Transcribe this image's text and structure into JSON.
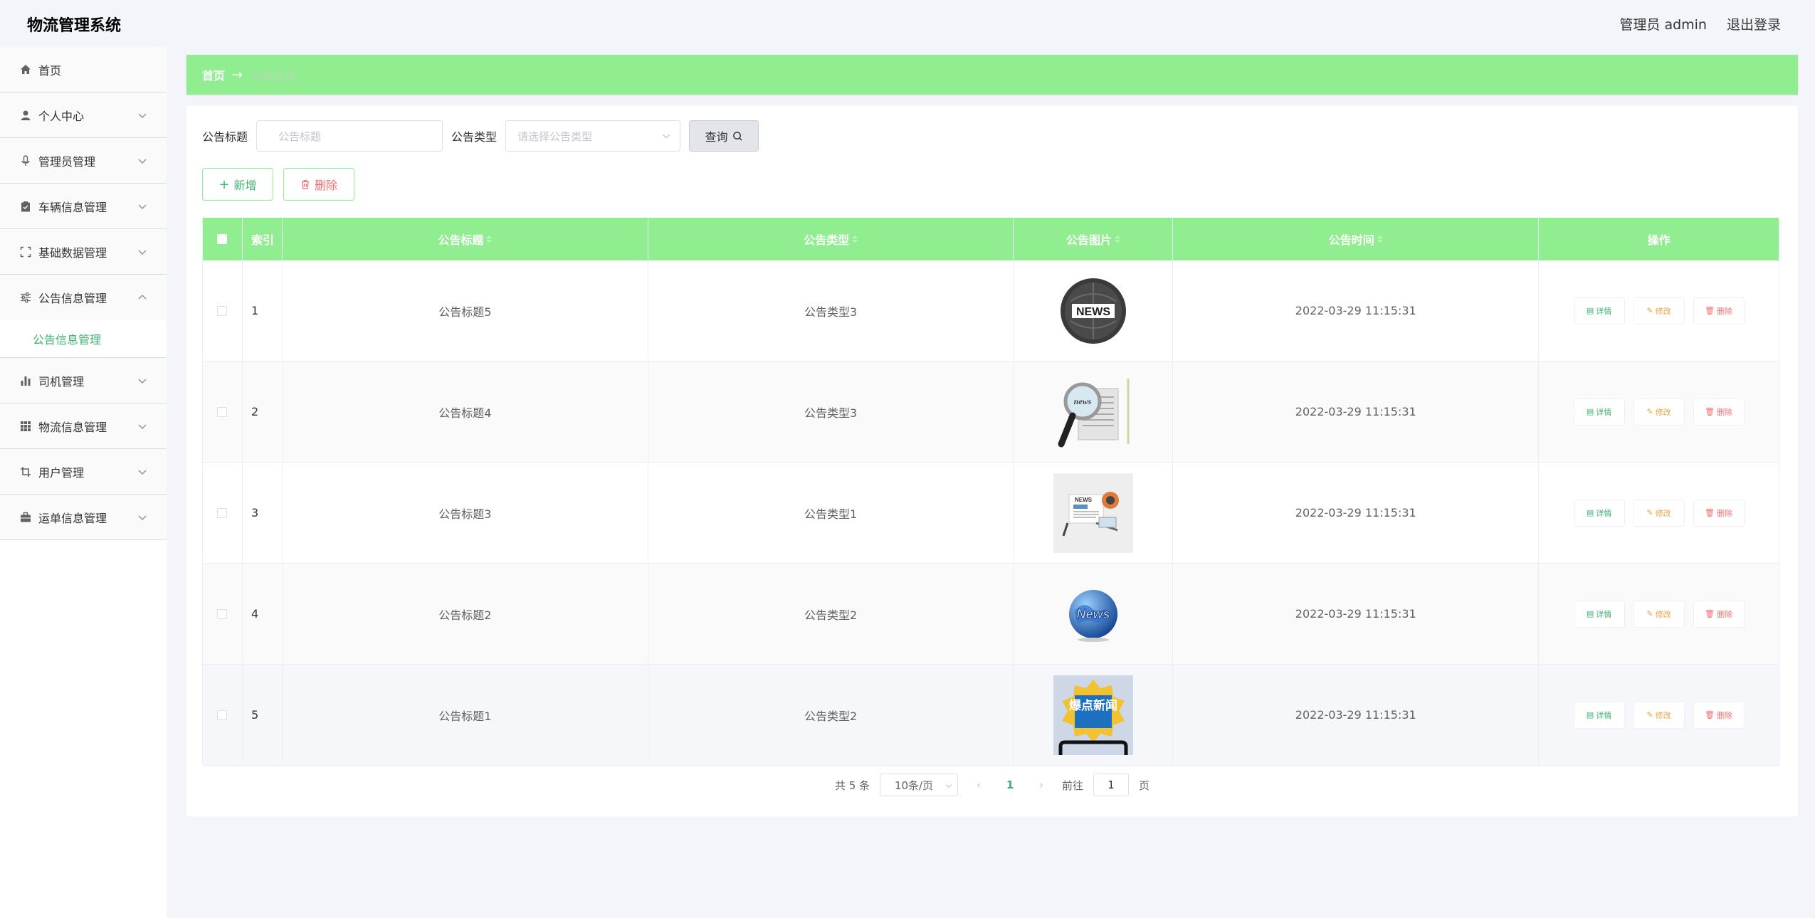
{
  "app": {
    "title": "物流管理系统"
  },
  "header": {
    "user_label": "管理员 admin",
    "logout_label": "退出登录"
  },
  "sidebar": {
    "items": [
      {
        "label": "首页",
        "icon": "home-icon"
      },
      {
        "label": "个人中心",
        "icon": "user-icon"
      },
      {
        "label": "管理员管理",
        "icon": "microphone-icon"
      },
      {
        "label": "车辆信息管理",
        "icon": "clipboard-icon"
      },
      {
        "label": "基础数据管理",
        "icon": "fullscreen-icon"
      },
      {
        "label": "公告信息管理",
        "icon": "sliders-icon",
        "expanded": true,
        "children": [
          "公告信息管理"
        ]
      },
      {
        "label": "司机管理",
        "icon": "bar-chart-icon"
      },
      {
        "label": "物流信息管理",
        "icon": "grid-icon"
      },
      {
        "label": "用户管理",
        "icon": "crop-icon"
      },
      {
        "label": "运单信息管理",
        "icon": "briefcase-icon"
      }
    ]
  },
  "breadcrumb": {
    "home": "首页",
    "arrow": "→",
    "current": "公告信息"
  },
  "search": {
    "title_label": "公告标题",
    "title_placeholder": "公告标题",
    "type_label": "公告类型",
    "type_placeholder": "请选择公告类型",
    "query_button": "查询"
  },
  "actions": {
    "add_label": "新增",
    "delete_label": "删除"
  },
  "table": {
    "columns": {
      "index": "索引",
      "title": "公告标题",
      "type": "公告类型",
      "picture": "公告图片",
      "time": "公告时间",
      "ops": "操作"
    },
    "op_labels": {
      "detail": "详情",
      "edit": "修改",
      "remove": "删除"
    },
    "rows": [
      {
        "index": "1",
        "title": "公告标题5",
        "type": "公告类型3",
        "picture": "news-globe-badge",
        "time": "2022-03-29 11:15:31"
      },
      {
        "index": "2",
        "title": "公告标题4",
        "type": "公告类型3",
        "picture": "magnifier-newspaper",
        "time": "2022-03-29 11:15:31"
      },
      {
        "index": "3",
        "title": "公告标题3",
        "type": "公告类型1",
        "picture": "news-flatlay",
        "time": "2022-03-29 11:15:31"
      },
      {
        "index": "4",
        "title": "公告标题2",
        "type": "公告类型2",
        "picture": "news-3d-globe",
        "time": "2022-03-29 11:15:31"
      },
      {
        "index": "5",
        "title": "公告标题1",
        "type": "公告类型2",
        "picture": "breaking-news-badge",
        "picture_text": "爆点新闻",
        "time": "2022-03-29 11:15:31"
      }
    ]
  },
  "pagination": {
    "total": "共 5 条",
    "page_size": "10条/页",
    "prev": "‹",
    "current": "1",
    "next": "›",
    "goto_label": "前往",
    "goto_value": "1",
    "page_unit": "页"
  },
  "colors": {
    "accent": "#90ee90",
    "accent_text": "#3cb371",
    "danger": "#f56c6c",
    "warning": "#e6a23c"
  }
}
